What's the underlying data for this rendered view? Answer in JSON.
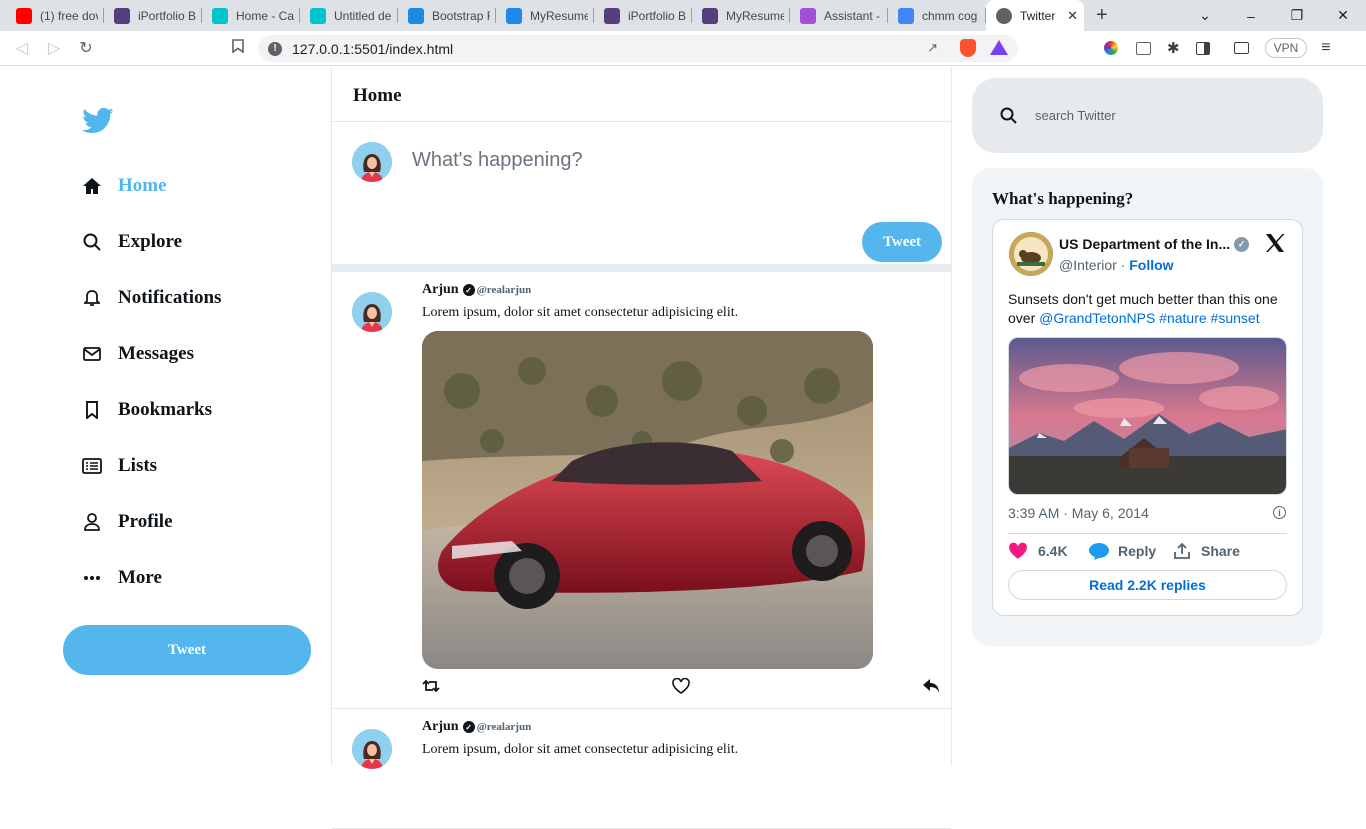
{
  "browser": {
    "tabs": [
      {
        "title": "(1) free dov",
        "favicon": "youtube-icon",
        "color": "#ff0000"
      },
      {
        "title": "iPortfolio B",
        "favicon": "bootstrap-icon",
        "color": "#563d7c"
      },
      {
        "title": "Home - Ca",
        "favicon": "canva-icon",
        "color": "#00c4cc"
      },
      {
        "title": "Untitled de",
        "favicon": "canva-icon",
        "color": "#00c4cc"
      },
      {
        "title": "Bootstrap F",
        "favicon": "bootstrap-studio-icon",
        "color": "#1e88e5"
      },
      {
        "title": "MyResume",
        "favicon": "bootstrap-studio-icon",
        "color": "#1e88e5"
      },
      {
        "title": "iPortfolio B",
        "favicon": "bootstrap-icon",
        "color": "#563d7c"
      },
      {
        "title": "MyResume",
        "favicon": "bootstrap-icon",
        "color": "#563d7c"
      },
      {
        "title": "Assistant -",
        "favicon": "assistant-icon",
        "color": "#a14fd6"
      },
      {
        "title": "chmm cog",
        "favicon": "google-icon",
        "color": "#4285f4"
      }
    ],
    "active_tab": {
      "title": "Twitter",
      "favicon": "globe-icon"
    },
    "url": "127.0.0.1:5501/index.html",
    "vpn_label": "VPN"
  },
  "sidebar": {
    "items": [
      {
        "label": "Home",
        "icon": "home-icon"
      },
      {
        "label": "Explore",
        "icon": "search-icon"
      },
      {
        "label": "Notifications",
        "icon": "bell-icon"
      },
      {
        "label": "Messages",
        "icon": "envelope-icon"
      },
      {
        "label": "Bookmarks",
        "icon": "bookmark-icon"
      },
      {
        "label": "Lists",
        "icon": "list-icon"
      },
      {
        "label": "Profile",
        "icon": "user-icon"
      },
      {
        "label": "More",
        "icon": "more-icon"
      }
    ],
    "tweet_label": "Tweet",
    "accent": "#4fb7ee"
  },
  "feed": {
    "title": "Home",
    "compose_placeholder": "What's happening?",
    "compose_button": "Tweet",
    "posts": [
      {
        "name": "Arjun",
        "handle": "@realarjun",
        "text": "Lorem ipsum, dolor sit amet consectetur adipisicing elit."
      },
      {
        "name": "Arjun",
        "handle": "@realarjun",
        "text": "Lorem ipsum, dolor sit amet consectetur adipisicing elit."
      }
    ]
  },
  "right": {
    "search_placeholder": "search Twitter",
    "trends_title": "What's happening?",
    "embed": {
      "account_name": "US Department of the In...",
      "handle": "@Interior",
      "separator": " · ",
      "follow": "Follow",
      "text_plain": "Sunsets don't get much better than this one over ",
      "mention": "@GrandTetonNPS",
      "tag1": "#nature",
      "tag2": "#sunset",
      "timestamp": "3:39 AM · May 6, 2014",
      "likes": "6.4K",
      "reply": "Reply",
      "share": "Share",
      "read_replies": "Read 2.2K replies"
    }
  }
}
